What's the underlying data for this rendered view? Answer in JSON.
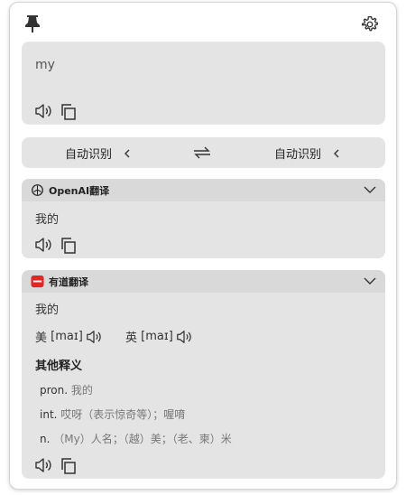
{
  "source": {
    "text": "my"
  },
  "lang": {
    "from": "自动识别",
    "to": "自动识别"
  },
  "openai": {
    "name": "OpenAI翻译",
    "result": "我的"
  },
  "youdao": {
    "name": "有道翻译",
    "word": "我的",
    "us_label": "美",
    "us_phonetic": "[maɪ]",
    "uk_label": "英",
    "uk_phonetic": "[maɪ]",
    "other_title": "其他释义",
    "definitions": [
      {
        "pos": "pron.",
        "meaning": "我的"
      },
      {
        "pos": "int.",
        "meaning": "哎呀（表示惊奇等）；喔唷"
      },
      {
        "pos": "n.",
        "meaning": "（My）人名；（越）美；（老、柬）米"
      }
    ]
  },
  "colors": {
    "card": "#e4e4e4",
    "header": "#d9d9d9",
    "youdao_red": "#e02727"
  }
}
